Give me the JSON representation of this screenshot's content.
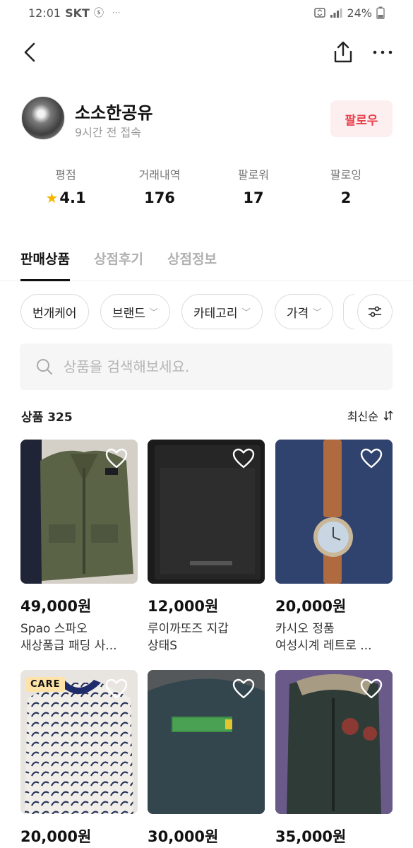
{
  "status_bar": {
    "time": "12:01",
    "carrier": "SKT",
    "battery": "24%"
  },
  "profile": {
    "shop_name": "소소한공유",
    "last_seen": "9시간 전 접속",
    "follow_label": "팔로우"
  },
  "stats": [
    {
      "label": "평점",
      "value": "4.1",
      "has_star": true
    },
    {
      "label": "거래내역",
      "value": "176"
    },
    {
      "label": "팔로워",
      "value": "17"
    },
    {
      "label": "팔로잉",
      "value": "2"
    }
  ],
  "tabs": [
    {
      "label": "판매상품",
      "active": true
    },
    {
      "label": "상점후기",
      "active": false
    },
    {
      "label": "상점정보",
      "active": false
    }
  ],
  "filters": [
    {
      "label": "번개케어",
      "dropdown": false
    },
    {
      "label": "브랜드",
      "dropdown": true
    },
    {
      "label": "카테고리",
      "dropdown": true
    },
    {
      "label": "가격",
      "dropdown": true
    }
  ],
  "search": {
    "placeholder": "상품을 검색해보세요."
  },
  "list": {
    "count_label": "상품 325",
    "sort_label": "최신순"
  },
  "products": [
    {
      "price": "49,000원",
      "title_line1": "Spao 스파오",
      "title_line2": "새상품급 패딩 사...",
      "badge": "",
      "image": "olive-jacket"
    },
    {
      "price": "12,000원",
      "title_line1": "루이까또즈 지갑",
      "title_line2": "상태S",
      "badge": "",
      "image": "black-wallet"
    },
    {
      "price": "20,000원",
      "title_line1": "카시오 정품",
      "title_line2": "여성시계 레트로 ...",
      "badge": "",
      "image": "watch"
    },
    {
      "price": "20,000원",
      "title_line1": "",
      "title_line2": "",
      "badge": "CARE",
      "image": "pattern-polo"
    },
    {
      "price": "30,000원",
      "title_line1": "",
      "title_line2": "",
      "badge": "",
      "image": "beanpole-coat"
    },
    {
      "price": "35,000원",
      "title_line1": "",
      "title_line2": "",
      "badge": "",
      "image": "parka"
    }
  ],
  "colors": {
    "accent": "#e8404c",
    "follow_bg": "#fdeff0",
    "star": "#f7b500"
  },
  "icons": [
    "back-arrow-icon",
    "share-icon",
    "more-icon",
    "search-icon",
    "filter-sliders-icon",
    "sort-icon",
    "heart-icon"
  ]
}
